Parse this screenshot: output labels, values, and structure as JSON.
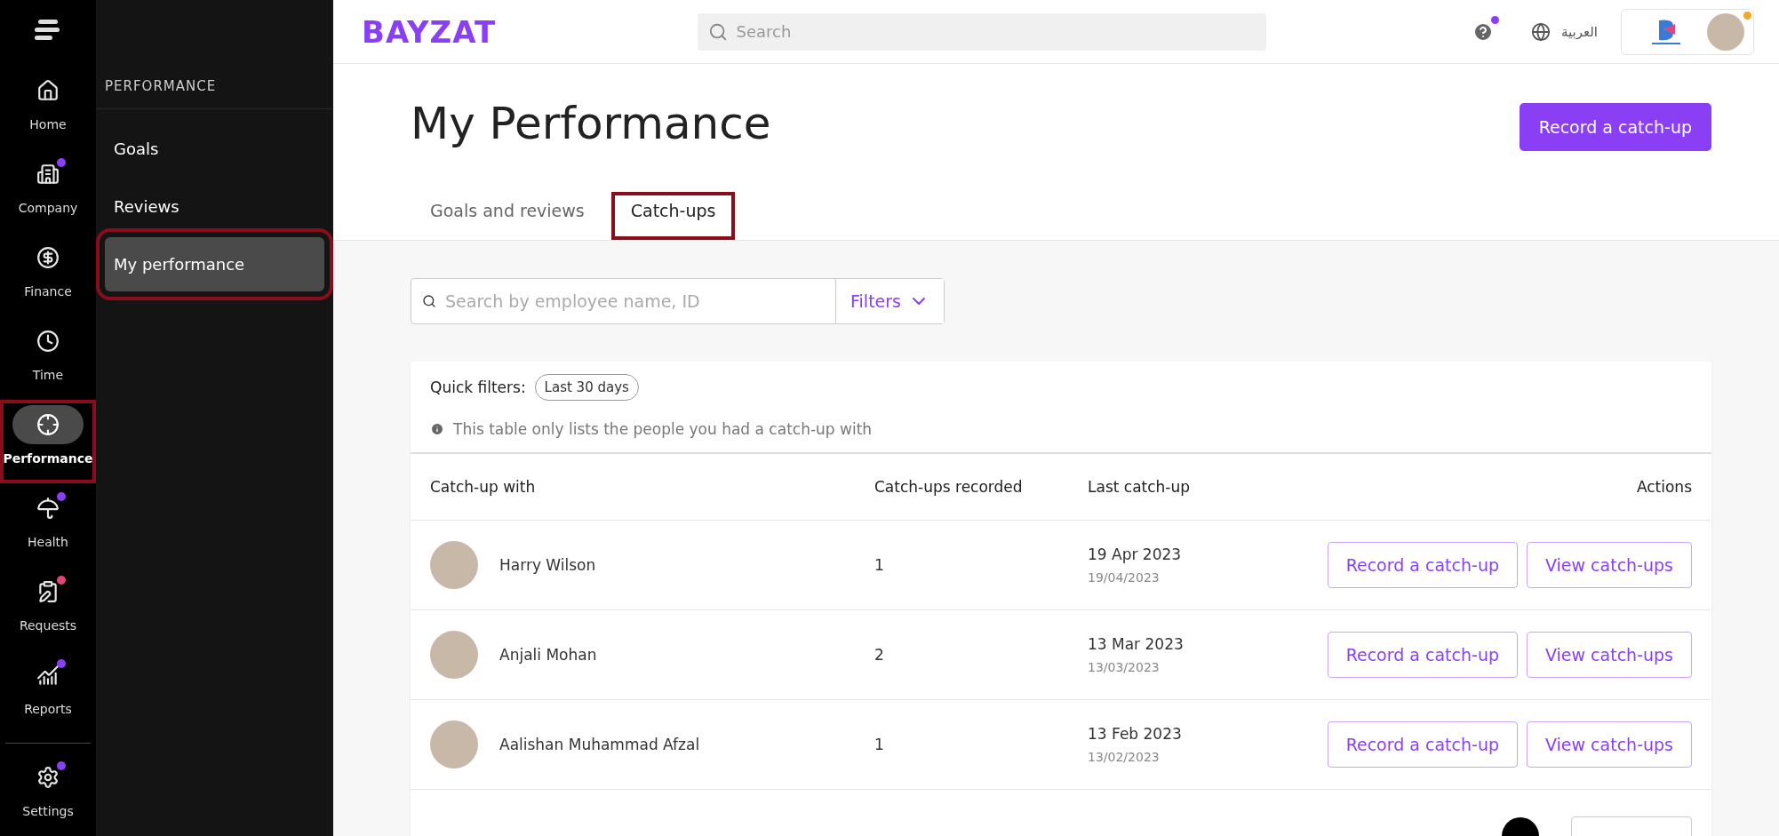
{
  "rail": {
    "items": [
      {
        "label": "Home",
        "selected": false,
        "highlighted": false
      },
      {
        "label": "Company",
        "selected": false,
        "highlighted": false,
        "color": "#8b3ff5"
      },
      {
        "label": "Finance",
        "selected": false,
        "highlighted": false
      },
      {
        "label": "Time",
        "selected": false,
        "highlighted": false
      },
      {
        "label": "Performance",
        "selected": true,
        "highlighted": true
      },
      {
        "label": "Health",
        "selected": false,
        "highlighted": false,
        "color": "#8b3ff5"
      },
      {
        "label": "Requests",
        "selected": false,
        "highlighted": false,
        "color": "#e0457b"
      },
      {
        "label": "Reports",
        "selected": false,
        "highlighted": false,
        "color": "#8b3ff5"
      }
    ],
    "footer": {
      "label": "Settings",
      "selected": false,
      "highlighted": false,
      "color": "#8b3ff5"
    }
  },
  "sidebar": {
    "heading": "PERFORMANCE",
    "items": [
      {
        "label": "Goals",
        "selected": false,
        "highlighted": false
      },
      {
        "label": "Reviews",
        "selected": false,
        "highlighted": false
      },
      {
        "label": "My performance",
        "selected": true,
        "highlighted": true
      }
    ]
  },
  "topbar": {
    "logo": "BAYZAT",
    "search": {
      "placeholder": "Search"
    },
    "language": "العربية",
    "help_badge": true,
    "profile_badge": true
  },
  "page": {
    "title": "My Performance",
    "primary_button": "Record a catch-up",
    "tabs": [
      {
        "label": "Goals and reviews",
        "selected": false,
        "highlighted": false
      },
      {
        "label": "Catch-ups",
        "selected": true,
        "highlighted": true
      }
    ],
    "search": {
      "placeholder": "Search by employee name, ID"
    },
    "filters_button": "Filters"
  },
  "table": {
    "quick_filters_label": "Quick filters:",
    "quick_filters": [
      "Last 30 days"
    ],
    "info": "This table only lists the people you had a catch-up with",
    "columns": [
      "Catch-up with",
      "Catch-ups recorded",
      "Last catch-up",
      "Actions"
    ],
    "rows": [
      {
        "name": "Harry Wilson",
        "count": "1",
        "date": "19 Apr 2023",
        "date_short": "19/04/2023",
        "actions": [
          "Record a catch-up",
          "View catch-ups"
        ]
      },
      {
        "name": "Anjali Mohan",
        "count": "2",
        "date": "13 Mar 2023",
        "date_short": "13/03/2023",
        "actions": [
          "Record a catch-up",
          "View catch-ups"
        ]
      },
      {
        "name": "Aalishan Muhammad Afzal",
        "count": "1",
        "date": "13 Feb 2023",
        "date_short": "13/02/2023",
        "actions": [
          "Record a catch-up",
          "View catch-ups"
        ]
      }
    ]
  }
}
